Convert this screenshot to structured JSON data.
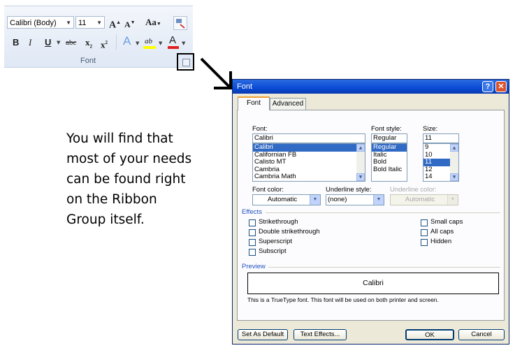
{
  "ribbon": {
    "font_name": "Calibri (Body)",
    "font_size": "11",
    "grow_font": "A",
    "shrink_font": "A",
    "change_case": "Aa",
    "bold": "B",
    "italic": "I",
    "underline": "U",
    "strikethrough": "abc",
    "subscript": "x",
    "superscript": "x",
    "text_effects": "A",
    "highlight": "ab",
    "font_color": "A",
    "group_label": "Font",
    "font_color_swatch": "#e02020",
    "highlight_swatch": "#ffff00"
  },
  "caption": {
    "lines": [
      "You will find that",
      "most of your needs",
      "can be found right",
      "on the Ribbon",
      "Group itself."
    ]
  },
  "dialog": {
    "title": "Font",
    "help": "?",
    "close": "✕",
    "tabs": [
      {
        "label": "Font"
      },
      {
        "label": "Advanced"
      }
    ],
    "font_label": "Font:",
    "font_value": "Calibri",
    "font_list": [
      "Calibri",
      "Californian FB",
      "Calisto MT",
      "Cambria",
      "Cambria Math"
    ],
    "style_label": "Font style:",
    "style_value": "Regular",
    "style_list": [
      "Regular",
      "Italic",
      "Bold",
      "Bold Italic"
    ],
    "size_label": "Size:",
    "size_value": "11",
    "size_list": [
      "9",
      "10",
      "11",
      "12",
      "14"
    ],
    "font_color_label": "Font color:",
    "font_color_value": "Automatic",
    "underline_style_label": "Underline style:",
    "underline_style_value": "(none)",
    "underline_color_label": "Underline color:",
    "underline_color_value": "Automatic",
    "effects_label": "Effects",
    "effects_left": [
      "Strikethrough",
      "Double strikethrough",
      "Superscript",
      "Subscript"
    ],
    "effects_right": [
      "Small caps",
      "All caps",
      "Hidden"
    ],
    "preview_label": "Preview",
    "preview_text": "Calibri",
    "preview_note": "This is a TrueType font. This font will be used on both printer and screen.",
    "set_default": "Set As Default",
    "text_effects": "Text Effects...",
    "ok": "OK",
    "cancel": "Cancel"
  }
}
